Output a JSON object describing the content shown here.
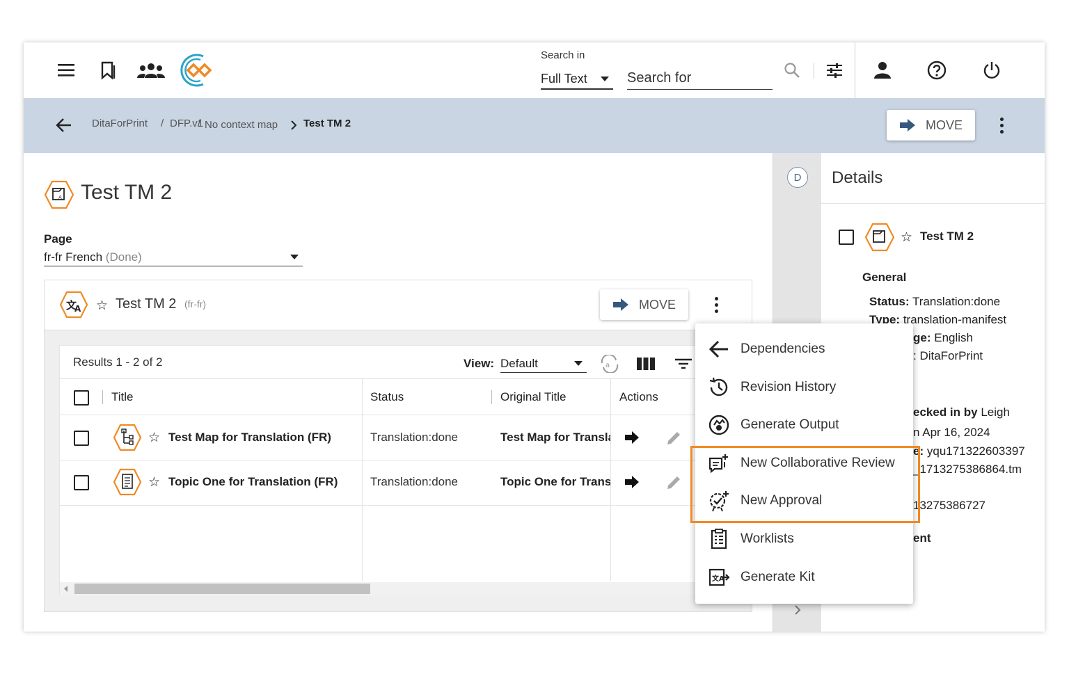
{
  "header": {
    "search_in_label": "Search in",
    "search_in_value": "Full Text",
    "search_placeholder": "Search for",
    "icons": [
      "menu-icon",
      "bookmark-icon",
      "group-icon",
      "app-logo",
      "search-icon",
      "filter-sliders-icon",
      "user-icon",
      "help-icon",
      "power-icon"
    ]
  },
  "breadcrumb": {
    "items": [
      "DitaForPrint",
      "/",
      "DFP.v1",
      "/",
      "No context map"
    ],
    "current": "Test TM 2",
    "move_label": "MOVE"
  },
  "page": {
    "title": "Test TM 2",
    "page_label": "Page",
    "page_value": "fr-fr French",
    "page_status": "(Done)"
  },
  "panel": {
    "title": "Test TM 2",
    "locale": "(fr-fr)",
    "move_label": "MOVE",
    "results": "Results 1 - 2 of 2",
    "view_label": "View:",
    "view_value": "Default",
    "columns": [
      "Title",
      "Status",
      "Original Title",
      "Actions"
    ],
    "rows": [
      {
        "title": "Test Map for Translation (FR)",
        "status": "Translation:done",
        "original": "Test Map for Translation (FR)",
        "icon": "map-icon"
      },
      {
        "title": "Topic One for Translation (FR)",
        "status": "Translation:done",
        "original": "Topic One for Translation (FR)",
        "icon": "topic-icon"
      }
    ]
  },
  "details": {
    "rail_letter": "D",
    "title": "Details",
    "item_title": "Test TM 2",
    "general_label": "General",
    "lines": [
      {
        "key": "Status:",
        "value": "Translation:done"
      },
      {
        "key": "Type:",
        "value": "translation-manifest"
      },
      {
        "key": "ge:",
        "value": "English"
      },
      {
        "key": "",
        "value": ": DitaForPrint"
      },
      {
        "key": "ecked in by",
        "value": "Leigh"
      },
      {
        "key": "",
        "value": "n Apr 16, 2024"
      },
      {
        "key": "e:",
        "value": "yqu171322603397"
      },
      {
        "key": "",
        "value": "_1713275386864.tm"
      },
      {
        "key": "",
        "value": "13275386727"
      },
      {
        "key": "ent",
        "value": ""
      }
    ]
  },
  "menu": {
    "items": [
      {
        "label": "Dependencies",
        "icon": "arrow-left-icon"
      },
      {
        "label": "Revision History",
        "icon": "history-icon"
      },
      {
        "label": "Generate Output",
        "icon": "generate-output-icon"
      },
      {
        "label": "New Collaborative Review",
        "icon": "collaborative-review-icon"
      },
      {
        "label": "New Approval",
        "icon": "approval-icon"
      },
      {
        "label": "Worklists",
        "icon": "worklist-icon"
      },
      {
        "label": "Generate Kit",
        "icon": "generate-kit-icon"
      }
    ]
  },
  "colors": {
    "crumb_bar": "#c9d5e3",
    "accent_orange": "#f08a24",
    "logo_teal": "#2aa3c9"
  }
}
